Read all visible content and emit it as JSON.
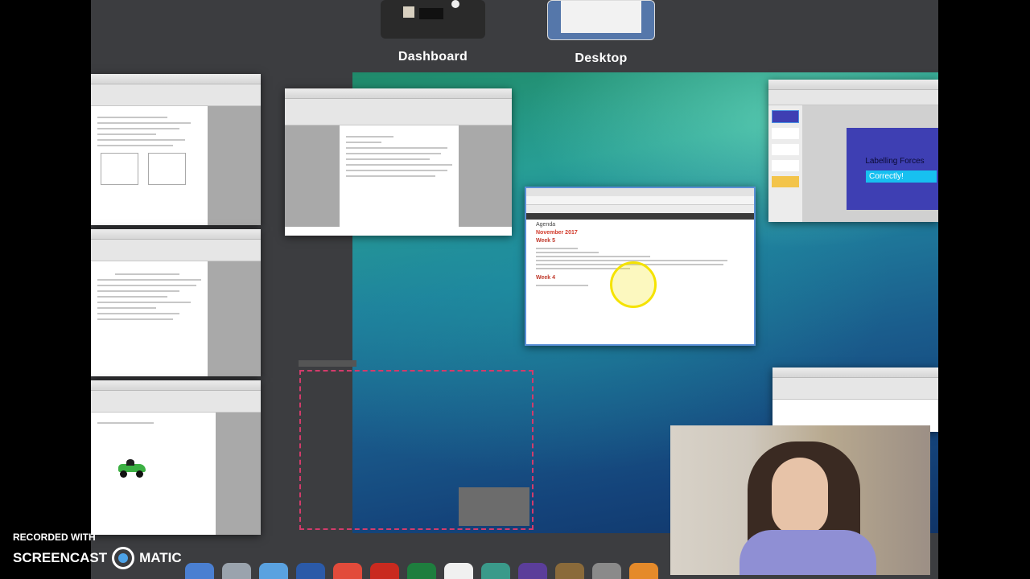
{
  "spaces": [
    {
      "label": "Dashboard"
    },
    {
      "label": "Desktop"
    }
  ],
  "slide_window": {
    "title": "Labelling Forces",
    "subtitle": "Correctly!"
  },
  "browser_window": {
    "heading": "Agenda",
    "month": "November 2017",
    "week_a": "Week 5",
    "week_b": "Week 4"
  },
  "watermark": {
    "line1": "RECORDED WITH",
    "brand_left": "SCREENCAST",
    "brand_right": "MATIC"
  },
  "dock_icons": [
    "finder-icon",
    "launchpad-icon",
    "safari-icon",
    "word-icon",
    "chrome-icon",
    "acrobat-icon",
    "excel-icon",
    "itunes-icon",
    "photos-icon",
    "imovie-icon",
    "pencil-icon",
    "system-preferences-icon",
    "screencast-icon"
  ],
  "colors": {
    "slide_bg": "#3e3fb3",
    "slide_button": "#17c0f0",
    "month_red": "#d23a2a",
    "week_red": "#c0392b",
    "highlight": "#f5e300",
    "selection": "#d33b6b"
  }
}
